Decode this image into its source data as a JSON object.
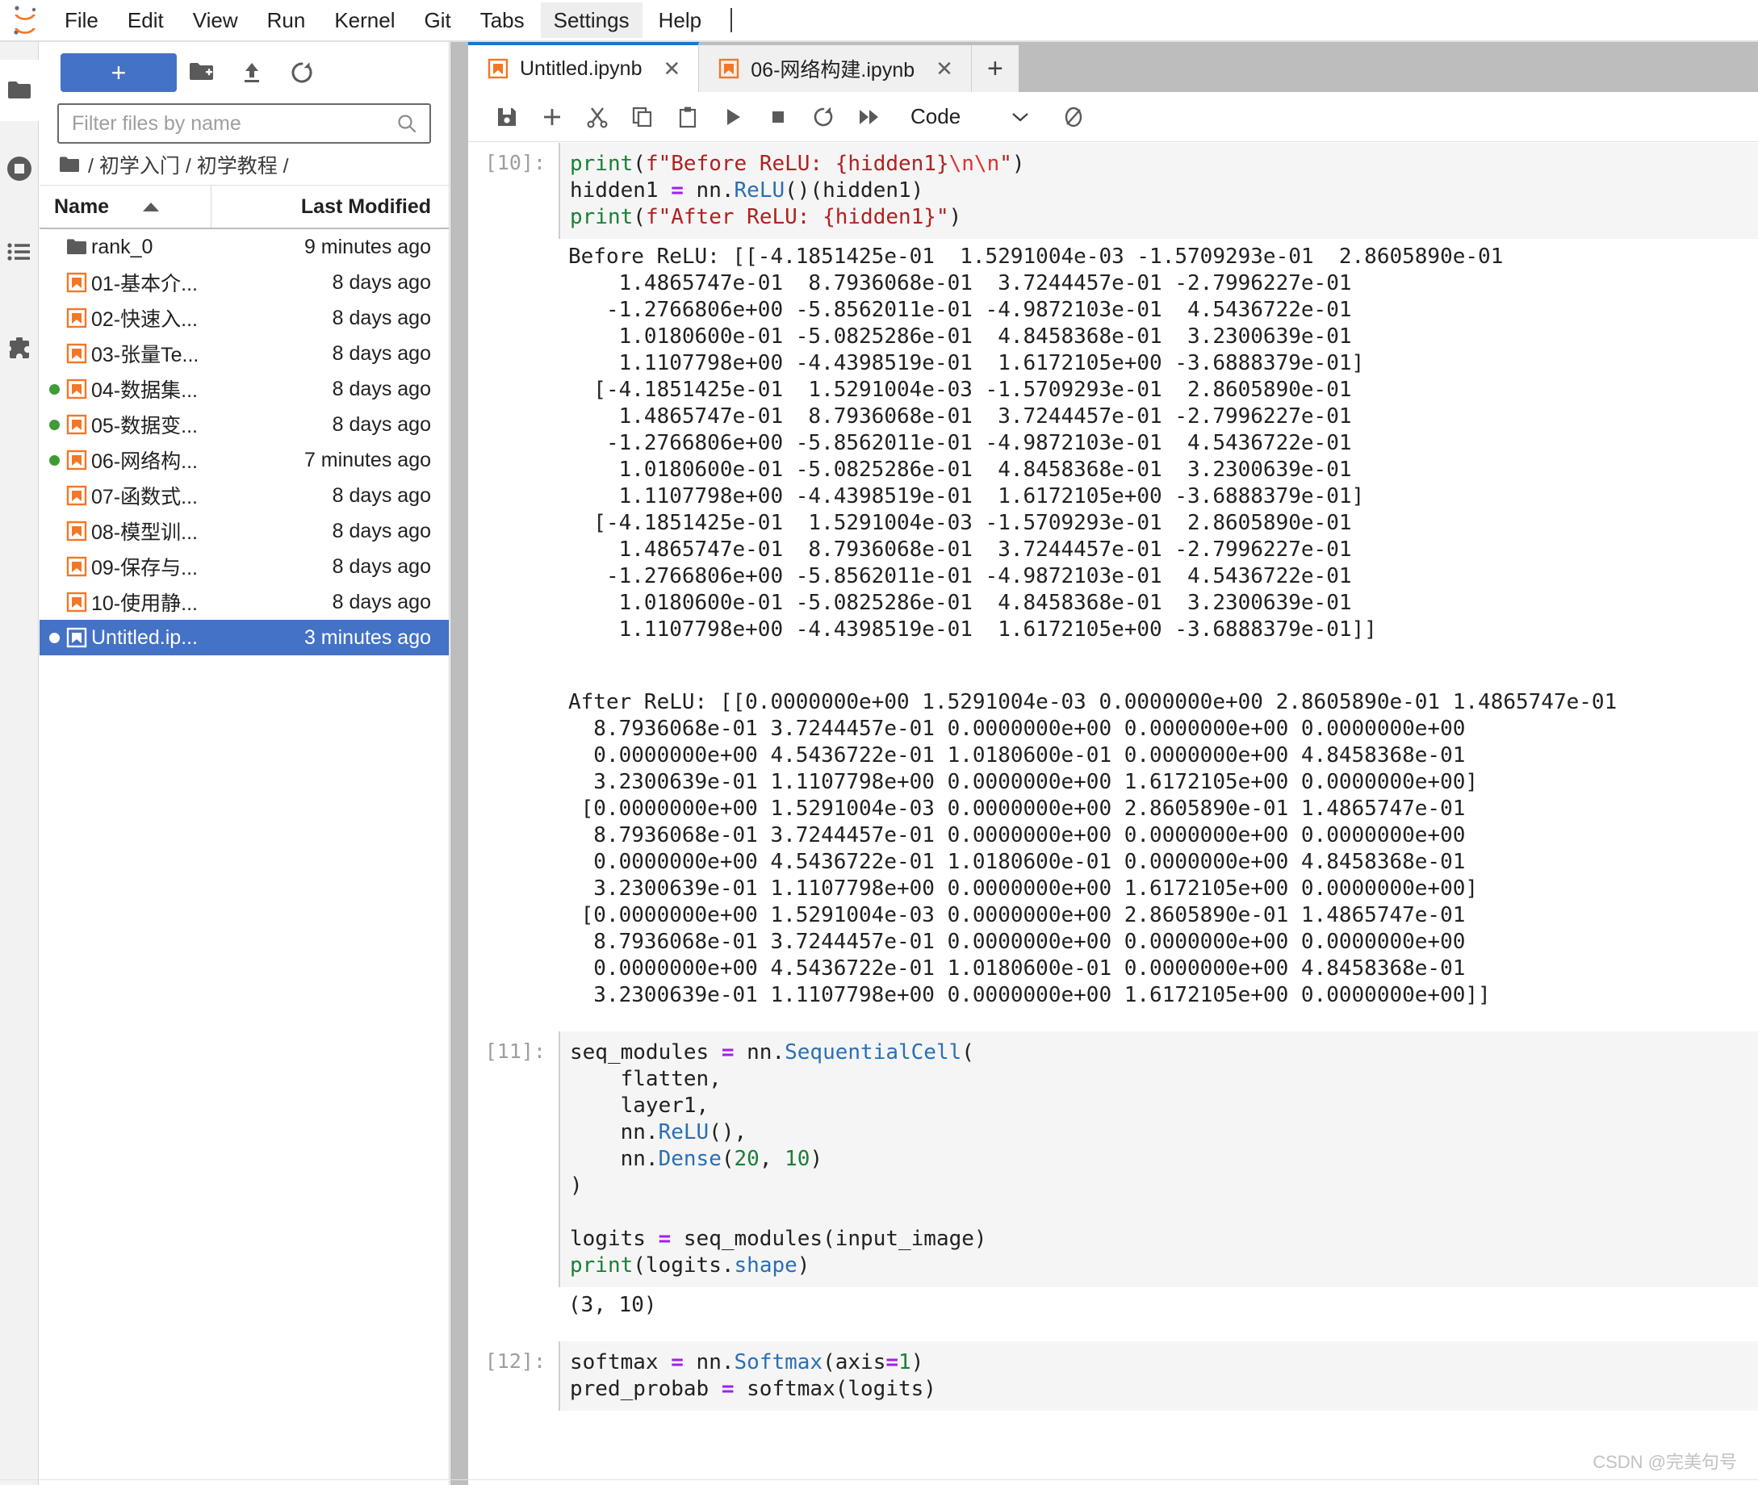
{
  "app": {
    "logo_icon": "jupyter-logo-icon",
    "watermark": "CSDN @完美句号"
  },
  "menubar": {
    "items": [
      {
        "label": "File",
        "name": "menu-file"
      },
      {
        "label": "Edit",
        "name": "menu-edit"
      },
      {
        "label": "View",
        "name": "menu-view"
      },
      {
        "label": "Run",
        "name": "menu-run"
      },
      {
        "label": "Kernel",
        "name": "menu-kernel"
      },
      {
        "label": "Git",
        "name": "menu-git"
      },
      {
        "label": "Tabs",
        "name": "menu-tabs"
      },
      {
        "label": "Settings",
        "name": "menu-settings",
        "hovered": true
      },
      {
        "label": "Help",
        "name": "menu-help"
      }
    ]
  },
  "activitybar": {
    "items": [
      {
        "icon": "folder-icon",
        "name": "sidebar-item-file-browser",
        "active": true
      },
      {
        "icon": "stop-circle-icon",
        "name": "sidebar-item-running-terminals",
        "active": false
      },
      {
        "icon": "list-icon",
        "name": "sidebar-item-commands",
        "active": false
      },
      {
        "icon": "puzzle-icon",
        "name": "sidebar-item-extensions",
        "active": false
      }
    ]
  },
  "filebrowser": {
    "new_launcher_label": "+",
    "new_folder_icon": "new-folder-icon",
    "upload_icon": "upload-icon",
    "refresh_icon": "refresh-icon",
    "filter": {
      "placeholder": "Filter files by name",
      "value": "",
      "search_icon": "search-icon"
    },
    "breadcrumb": {
      "home_icon": "folder-icon",
      "path": "/ 初学入门 / 初学教程 /"
    },
    "columns": {
      "name": "Name",
      "last_modified": "Last Modified",
      "sort_icon": "caret-up-icon"
    },
    "rows": [
      {
        "name": "rank_0",
        "modified": "9 minutes ago",
        "icon": "folder-icon",
        "running": false,
        "selected": false
      },
      {
        "name": "01-基本介...",
        "modified": "8 days ago",
        "icon": "notebook-icon",
        "running": false,
        "selected": false
      },
      {
        "name": "02-快速入...",
        "modified": "8 days ago",
        "icon": "notebook-icon",
        "running": false,
        "selected": false
      },
      {
        "name": "03-张量Te...",
        "modified": "8 days ago",
        "icon": "notebook-icon",
        "running": false,
        "selected": false
      },
      {
        "name": "04-数据集...",
        "modified": "8 days ago",
        "icon": "notebook-icon",
        "running": true,
        "selected": false
      },
      {
        "name": "05-数据变...",
        "modified": "8 days ago",
        "icon": "notebook-icon",
        "running": true,
        "selected": false
      },
      {
        "name": "06-网络构...",
        "modified": "7 minutes ago",
        "icon": "notebook-icon",
        "running": true,
        "selected": false
      },
      {
        "name": "07-函数式...",
        "modified": "8 days ago",
        "icon": "notebook-icon",
        "running": false,
        "selected": false
      },
      {
        "name": "08-模型训...",
        "modified": "8 days ago",
        "icon": "notebook-icon",
        "running": false,
        "selected": false
      },
      {
        "name": "09-保存与...",
        "modified": "8 days ago",
        "icon": "notebook-icon",
        "running": false,
        "selected": false
      },
      {
        "name": "10-使用静...",
        "modified": "8 days ago",
        "icon": "notebook-icon",
        "running": false,
        "selected": false
      },
      {
        "name": "Untitled.ip...",
        "modified": "3 minutes ago",
        "icon": "notebook-icon",
        "running": true,
        "selected": true
      }
    ]
  },
  "tabbar": {
    "tabs": [
      {
        "label": "Untitled.ipynb",
        "icon": "notebook-icon",
        "active": true,
        "close": "✕"
      },
      {
        "label": "06-网络构建.ipynb",
        "icon": "notebook-icon",
        "active": false,
        "close": "✕"
      }
    ],
    "add_label": "+"
  },
  "notebook_toolbar": {
    "buttons": [
      {
        "icon": "save-icon",
        "name": "save-button"
      },
      {
        "icon": "add-cell-icon",
        "name": "insert-cell-button"
      },
      {
        "icon": "cut-icon",
        "name": "cut-cell-button"
      },
      {
        "icon": "copy-icon",
        "name": "copy-cell-button"
      },
      {
        "icon": "paste-icon",
        "name": "paste-cell-button"
      },
      {
        "icon": "run-icon",
        "name": "run-cell-button"
      },
      {
        "icon": "stop-icon",
        "name": "interrupt-kernel-button"
      },
      {
        "icon": "restart-icon",
        "name": "restart-kernel-button"
      },
      {
        "icon": "fast-forward-icon",
        "name": "restart-and-run-all-button"
      }
    ],
    "celltype": {
      "value": "Code",
      "caret_icon": "chevron-down-icon"
    },
    "kernel_status_icon": "kernel-busy-icon"
  },
  "notebook": {
    "cells": [
      {
        "prompt": "[10]:",
        "type": "code",
        "source_lines": [
          [
            {
              "t": "print",
              "c": "builtin"
            },
            {
              "t": "(",
              "c": "plain"
            },
            {
              "t": "f\"Before ReLU: {hidden1}",
              "c": "str"
            },
            {
              "t": "\\n\\n",
              "c": "esc"
            },
            {
              "t": "\"",
              "c": "str"
            },
            {
              "t": ")",
              "c": "plain"
            }
          ],
          [
            {
              "t": "hidden1 ",
              "c": "plain"
            },
            {
              "t": "=",
              "c": "op"
            },
            {
              "t": " nn.",
              "c": "plain"
            },
            {
              "t": "ReLU",
              "c": "cls"
            },
            {
              "t": "()(hidden1)",
              "c": "plain"
            }
          ],
          [
            {
              "t": "print",
              "c": "builtin"
            },
            {
              "t": "(",
              "c": "plain"
            },
            {
              "t": "f\"After ReLU: {hidden1}\"",
              "c": "str"
            },
            {
              "t": ")",
              "c": "plain"
            }
          ]
        ],
        "outputs": [
          "Before ReLU: [[-4.1851425e-01  1.5291004e-03 -1.5709293e-01  2.8605890e-01\n    1.4865747e-01  8.7936068e-01  3.7244457e-01 -2.7996227e-01\n   -1.2766806e+00 -5.8562011e-01 -4.9872103e-01  4.5436722e-01\n    1.0180600e-01 -5.0825286e-01  4.8458368e-01  3.2300639e-01\n    1.1107798e+00 -4.4398519e-01  1.6172105e+00 -3.6888379e-01]\n  [-4.1851425e-01  1.5291004e-03 -1.5709293e-01  2.8605890e-01\n    1.4865747e-01  8.7936068e-01  3.7244457e-01 -2.7996227e-01\n   -1.2766806e+00 -5.8562011e-01 -4.9872103e-01  4.5436722e-01\n    1.0180600e-01 -5.0825286e-01  4.8458368e-01  3.2300639e-01\n    1.1107798e+00 -4.4398519e-01  1.6172105e+00 -3.6888379e-01]\n  [-4.1851425e-01  1.5291004e-03 -1.5709293e-01  2.8605890e-01\n    1.4865747e-01  8.7936068e-01  3.7244457e-01 -2.7996227e-01\n   -1.2766806e+00 -5.8562011e-01 -4.9872103e-01  4.5436722e-01\n    1.0180600e-01 -5.0825286e-01  4.8458368e-01  3.2300639e-01\n    1.1107798e+00 -4.4398519e-01  1.6172105e+00 -3.6888379e-01]]",
          "",
          "After ReLU: [[0.0000000e+00 1.5291004e-03 0.0000000e+00 2.8605890e-01 1.4865747e-01\n  8.7936068e-01 3.7244457e-01 0.0000000e+00 0.0000000e+00 0.0000000e+00\n  0.0000000e+00 4.5436722e-01 1.0180600e-01 0.0000000e+00 4.8458368e-01\n  3.2300639e-01 1.1107798e+00 0.0000000e+00 1.6172105e+00 0.0000000e+00]\n [0.0000000e+00 1.5291004e-03 0.0000000e+00 2.8605890e-01 1.4865747e-01\n  8.7936068e-01 3.7244457e-01 0.0000000e+00 0.0000000e+00 0.0000000e+00\n  0.0000000e+00 4.5436722e-01 1.0180600e-01 0.0000000e+00 4.8458368e-01\n  3.2300639e-01 1.1107798e+00 0.0000000e+00 1.6172105e+00 0.0000000e+00]\n [0.0000000e+00 1.5291004e-03 0.0000000e+00 2.8605890e-01 1.4865747e-01\n  8.7936068e-01 3.7244457e-01 0.0000000e+00 0.0000000e+00 0.0000000e+00\n  0.0000000e+00 4.5436722e-01 1.0180600e-01 0.0000000e+00 4.8458368e-01\n  3.2300639e-01 1.1107798e+00 0.0000000e+00 1.6172105e+00 0.0000000e+00]]"
        ]
      },
      {
        "prompt": "[11]:",
        "type": "code",
        "source_lines": [
          [
            {
              "t": "seq_modules ",
              "c": "plain"
            },
            {
              "t": "=",
              "c": "op"
            },
            {
              "t": " nn.",
              "c": "plain"
            },
            {
              "t": "SequentialCell",
              "c": "cls"
            },
            {
              "t": "(",
              "c": "plain"
            }
          ],
          [
            {
              "t": "    flatten,",
              "c": "plain"
            }
          ],
          [
            {
              "t": "    layer1,",
              "c": "plain"
            }
          ],
          [
            {
              "t": "    nn.",
              "c": "plain"
            },
            {
              "t": "ReLU",
              "c": "cls"
            },
            {
              "t": "(),",
              "c": "plain"
            }
          ],
          [
            {
              "t": "    nn.",
              "c": "plain"
            },
            {
              "t": "Dense",
              "c": "cls"
            },
            {
              "t": "(",
              "c": "plain"
            },
            {
              "t": "20",
              "c": "num"
            },
            {
              "t": ", ",
              "c": "plain"
            },
            {
              "t": "10",
              "c": "num"
            },
            {
              "t": ")",
              "c": "plain"
            }
          ],
          [
            {
              "t": ")",
              "c": "plain"
            }
          ],
          [
            {
              "t": "",
              "c": "plain"
            }
          ],
          [
            {
              "t": "logits ",
              "c": "plain"
            },
            {
              "t": "=",
              "c": "op"
            },
            {
              "t": " seq_modules(input_image)",
              "c": "plain"
            }
          ],
          [
            {
              "t": "print",
              "c": "builtin"
            },
            {
              "t": "(logits.",
              "c": "plain"
            },
            {
              "t": "shape",
              "c": "cls"
            },
            {
              "t": ")",
              "c": "plain"
            }
          ]
        ],
        "outputs": [
          "(3, 10)"
        ]
      },
      {
        "prompt": "[12]:",
        "type": "code",
        "source_lines": [
          [
            {
              "t": "softmax ",
              "c": "plain"
            },
            {
              "t": "=",
              "c": "op"
            },
            {
              "t": " nn.",
              "c": "plain"
            },
            {
              "t": "Softmax",
              "c": "cls"
            },
            {
              "t": "(axis",
              "c": "plain"
            },
            {
              "t": "=",
              "c": "op"
            },
            {
              "t": "1",
              "c": "num"
            },
            {
              "t": ")",
              "c": "plain"
            }
          ],
          [
            {
              "t": "pred_probab ",
              "c": "plain"
            },
            {
              "t": "=",
              "c": "op"
            },
            {
              "t": " softmax(logits)",
              "c": "plain"
            }
          ]
        ],
        "outputs": []
      }
    ]
  },
  "colors": {
    "accent_blue": "#4472c4",
    "tab_active_border": "#1976d2",
    "jupyter_orange": "#f37726",
    "running_green": "#3f9c35",
    "cell_bg": "#f5f5f5"
  }
}
